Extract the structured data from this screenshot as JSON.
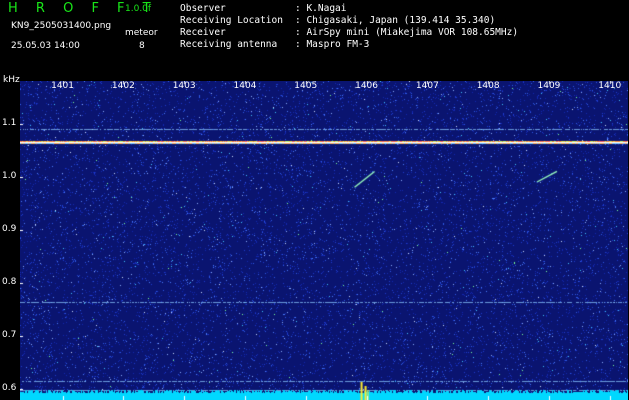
{
  "header": {
    "title": "H R O F F T",
    "version": "1.0.0f",
    "filename": "KN9_2505031400.png",
    "meteor_label": "meteor",
    "datetime": "25.05.03 14:00",
    "meteor_count": "8",
    "info": [
      {
        "label": "Observer",
        "value": ": K.Nagai"
      },
      {
        "label": "Receiving Location",
        "value": ": Chigasaki, Japan (139.414 35.340)"
      },
      {
        "label": "Receiver",
        "value": ": AirSpy mini (Miakejima VOR 108.65MHz)"
      },
      {
        "label": "Receiving antenna",
        "value": ": Maspro FM-3"
      }
    ]
  },
  "chart_data": {
    "type": "heatmap",
    "title": "",
    "xlabel": "",
    "ylabel": "kHz",
    "x_ticks": [
      "1401",
      "1402",
      "1403",
      "1404",
      "1405",
      "1406",
      "1407",
      "1408",
      "1409",
      "1410"
    ],
    "y_ticks": [
      "1.1",
      "1.0",
      "0.9",
      "0.8",
      "0.7",
      "0.6"
    ],
    "y_range_khz": [
      0.58,
      1.18
    ],
    "carrier_khz": 1.065,
    "horizontal_lines_khz": [
      1.09,
      1.065,
      0.765,
      0.615,
      0.598
    ],
    "meteor_echoes": [
      {
        "time": "1406",
        "freq_khz": [
          0.98,
          1.01
        ]
      },
      {
        "time": "1409",
        "freq_khz": [
          0.99,
          1.01
        ]
      }
    ],
    "colors": {
      "background": "#000000",
      "noise_low": "#1a2ea8",
      "noise_high": "#9ab4ff",
      "carrier": "#ff9a3c",
      "floor": "#00d8ff"
    }
  }
}
